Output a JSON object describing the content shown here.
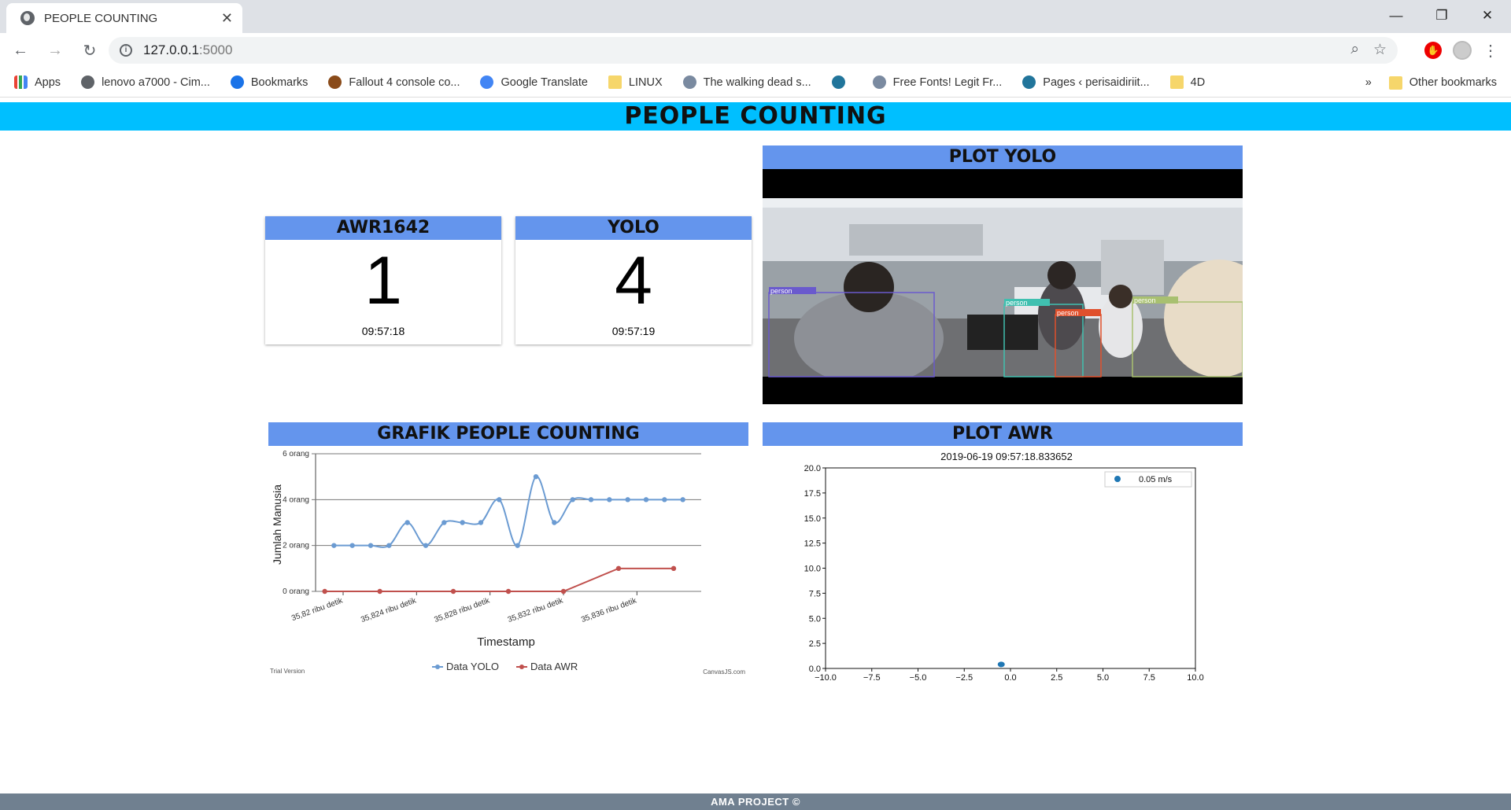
{
  "browser": {
    "tab_title": "PEOPLE COUNTING",
    "url_host": "127.0.0.1",
    "url_port": ":5000",
    "bookmarks": [
      {
        "label": "Apps",
        "icon": "apps-icon"
      },
      {
        "label": "lenovo a7000 - Cim...",
        "icon": "globe-icon"
      },
      {
        "label": "Bookmarks",
        "icon": "star-icon"
      },
      {
        "label": "Fallout 4 console co...",
        "icon": "fallout-icon"
      },
      {
        "label": "Google Translate",
        "icon": "translate-icon"
      },
      {
        "label": "LINUX",
        "icon": "folder-icon"
      },
      {
        "label": "The walking dead s...",
        "icon": "site-icon"
      },
      {
        "label": "",
        "icon": "wordpress-icon"
      },
      {
        "label": "Free Fonts! Legit Fr...",
        "icon": "site-icon"
      },
      {
        "label": "Pages ‹ perisaidiriit...",
        "icon": "wordpress-icon"
      },
      {
        "label": "4D",
        "icon": "folder-icon"
      }
    ],
    "overflow_chevron": "»",
    "other_bookmarks": "Other bookmarks"
  },
  "header": {
    "title": "PEOPLE COUNTING"
  },
  "cards": {
    "awr": {
      "title": "AWR1642",
      "count": "1",
      "time": "09:57:18"
    },
    "yolo": {
      "title": "YOLO",
      "count": "4",
      "time": "09:57:19"
    }
  },
  "plot_yolo": {
    "title": "PLOT YOLO",
    "detections": [
      "person",
      "person",
      "person",
      "person"
    ]
  },
  "grafik": {
    "title": "GRAFIK PEOPLE COUNTING",
    "ylabel": "Jumlah Manusia",
    "xlabel": "Timestamp",
    "yticks": [
      "0 orang",
      "2 orang",
      "4 orang",
      "6 orang"
    ],
    "xticks": [
      "35,82 ribu detik",
      "35,824 ribu detik",
      "35,828 ribu detik",
      "35,832 ribu detik",
      "35,836 ribu detik"
    ],
    "legend_yolo": "Data YOLO",
    "legend_awr": "Data AWR",
    "trial": "Trial Version",
    "credit": "CanvasJS.com"
  },
  "plot_awr": {
    "title": "PLOT AWR",
    "timestamp": "2019-06-19 09:57:18.833652",
    "legend": "0.05 m/s",
    "yticks": [
      "0.0",
      "2.5",
      "5.0",
      "7.5",
      "10.0",
      "12.5",
      "15.0",
      "17.5",
      "20.0"
    ],
    "xticks": [
      "−10.0",
      "−7.5",
      "−5.0",
      "−2.5",
      "0.0",
      "2.5",
      "5.0",
      "7.5",
      "10.0"
    ]
  },
  "chart_data": [
    {
      "type": "line",
      "title": "GRAFIK PEOPLE COUNTING",
      "xlabel": "Timestamp",
      "ylabel": "Jumlah Manusia",
      "ylim": [
        0,
        6
      ],
      "xlim": [
        35818.5,
        35839.5
      ],
      "series": [
        {
          "name": "Data YOLO",
          "color": "#6b9bd2",
          "x": [
            35819.5,
            35820.5,
            35821.5,
            35822.5,
            35823.5,
            35824.5,
            35825.5,
            35826.5,
            35827.5,
            35828.5,
            35829.5,
            35830.5,
            35831.5,
            35832.5,
            35833.5,
            35834.5,
            35835.5,
            35836.5,
            35837.5,
            35838.5
          ],
          "y": [
            2,
            2,
            2,
            2,
            3,
            2,
            3,
            3,
            3,
            4,
            2,
            5,
            3,
            4,
            4,
            4,
            4,
            4,
            4,
            4
          ]
        },
        {
          "name": "Data AWR",
          "color": "#c0504d",
          "x": [
            35819.0,
            35822.0,
            35826.0,
            35829.0,
            35832.0,
            35835.0,
            35838.0
          ],
          "y": [
            0,
            0,
            0,
            0,
            0,
            1,
            1
          ]
        }
      ]
    },
    {
      "type": "scatter",
      "title": "2019-06-19 09:57:18.833652",
      "xlim": [
        -10,
        10
      ],
      "ylim": [
        0,
        20
      ],
      "series": [
        {
          "name": "0.05 m/s",
          "color": "#1f77b4",
          "x": [
            -0.5
          ],
          "y": [
            0.4
          ]
        }
      ]
    }
  ],
  "footer": {
    "text": "AMA PROJECT ©"
  },
  "colors": {
    "header": "#00bfff",
    "card_head": "#6495ed",
    "footer": "#708090"
  }
}
